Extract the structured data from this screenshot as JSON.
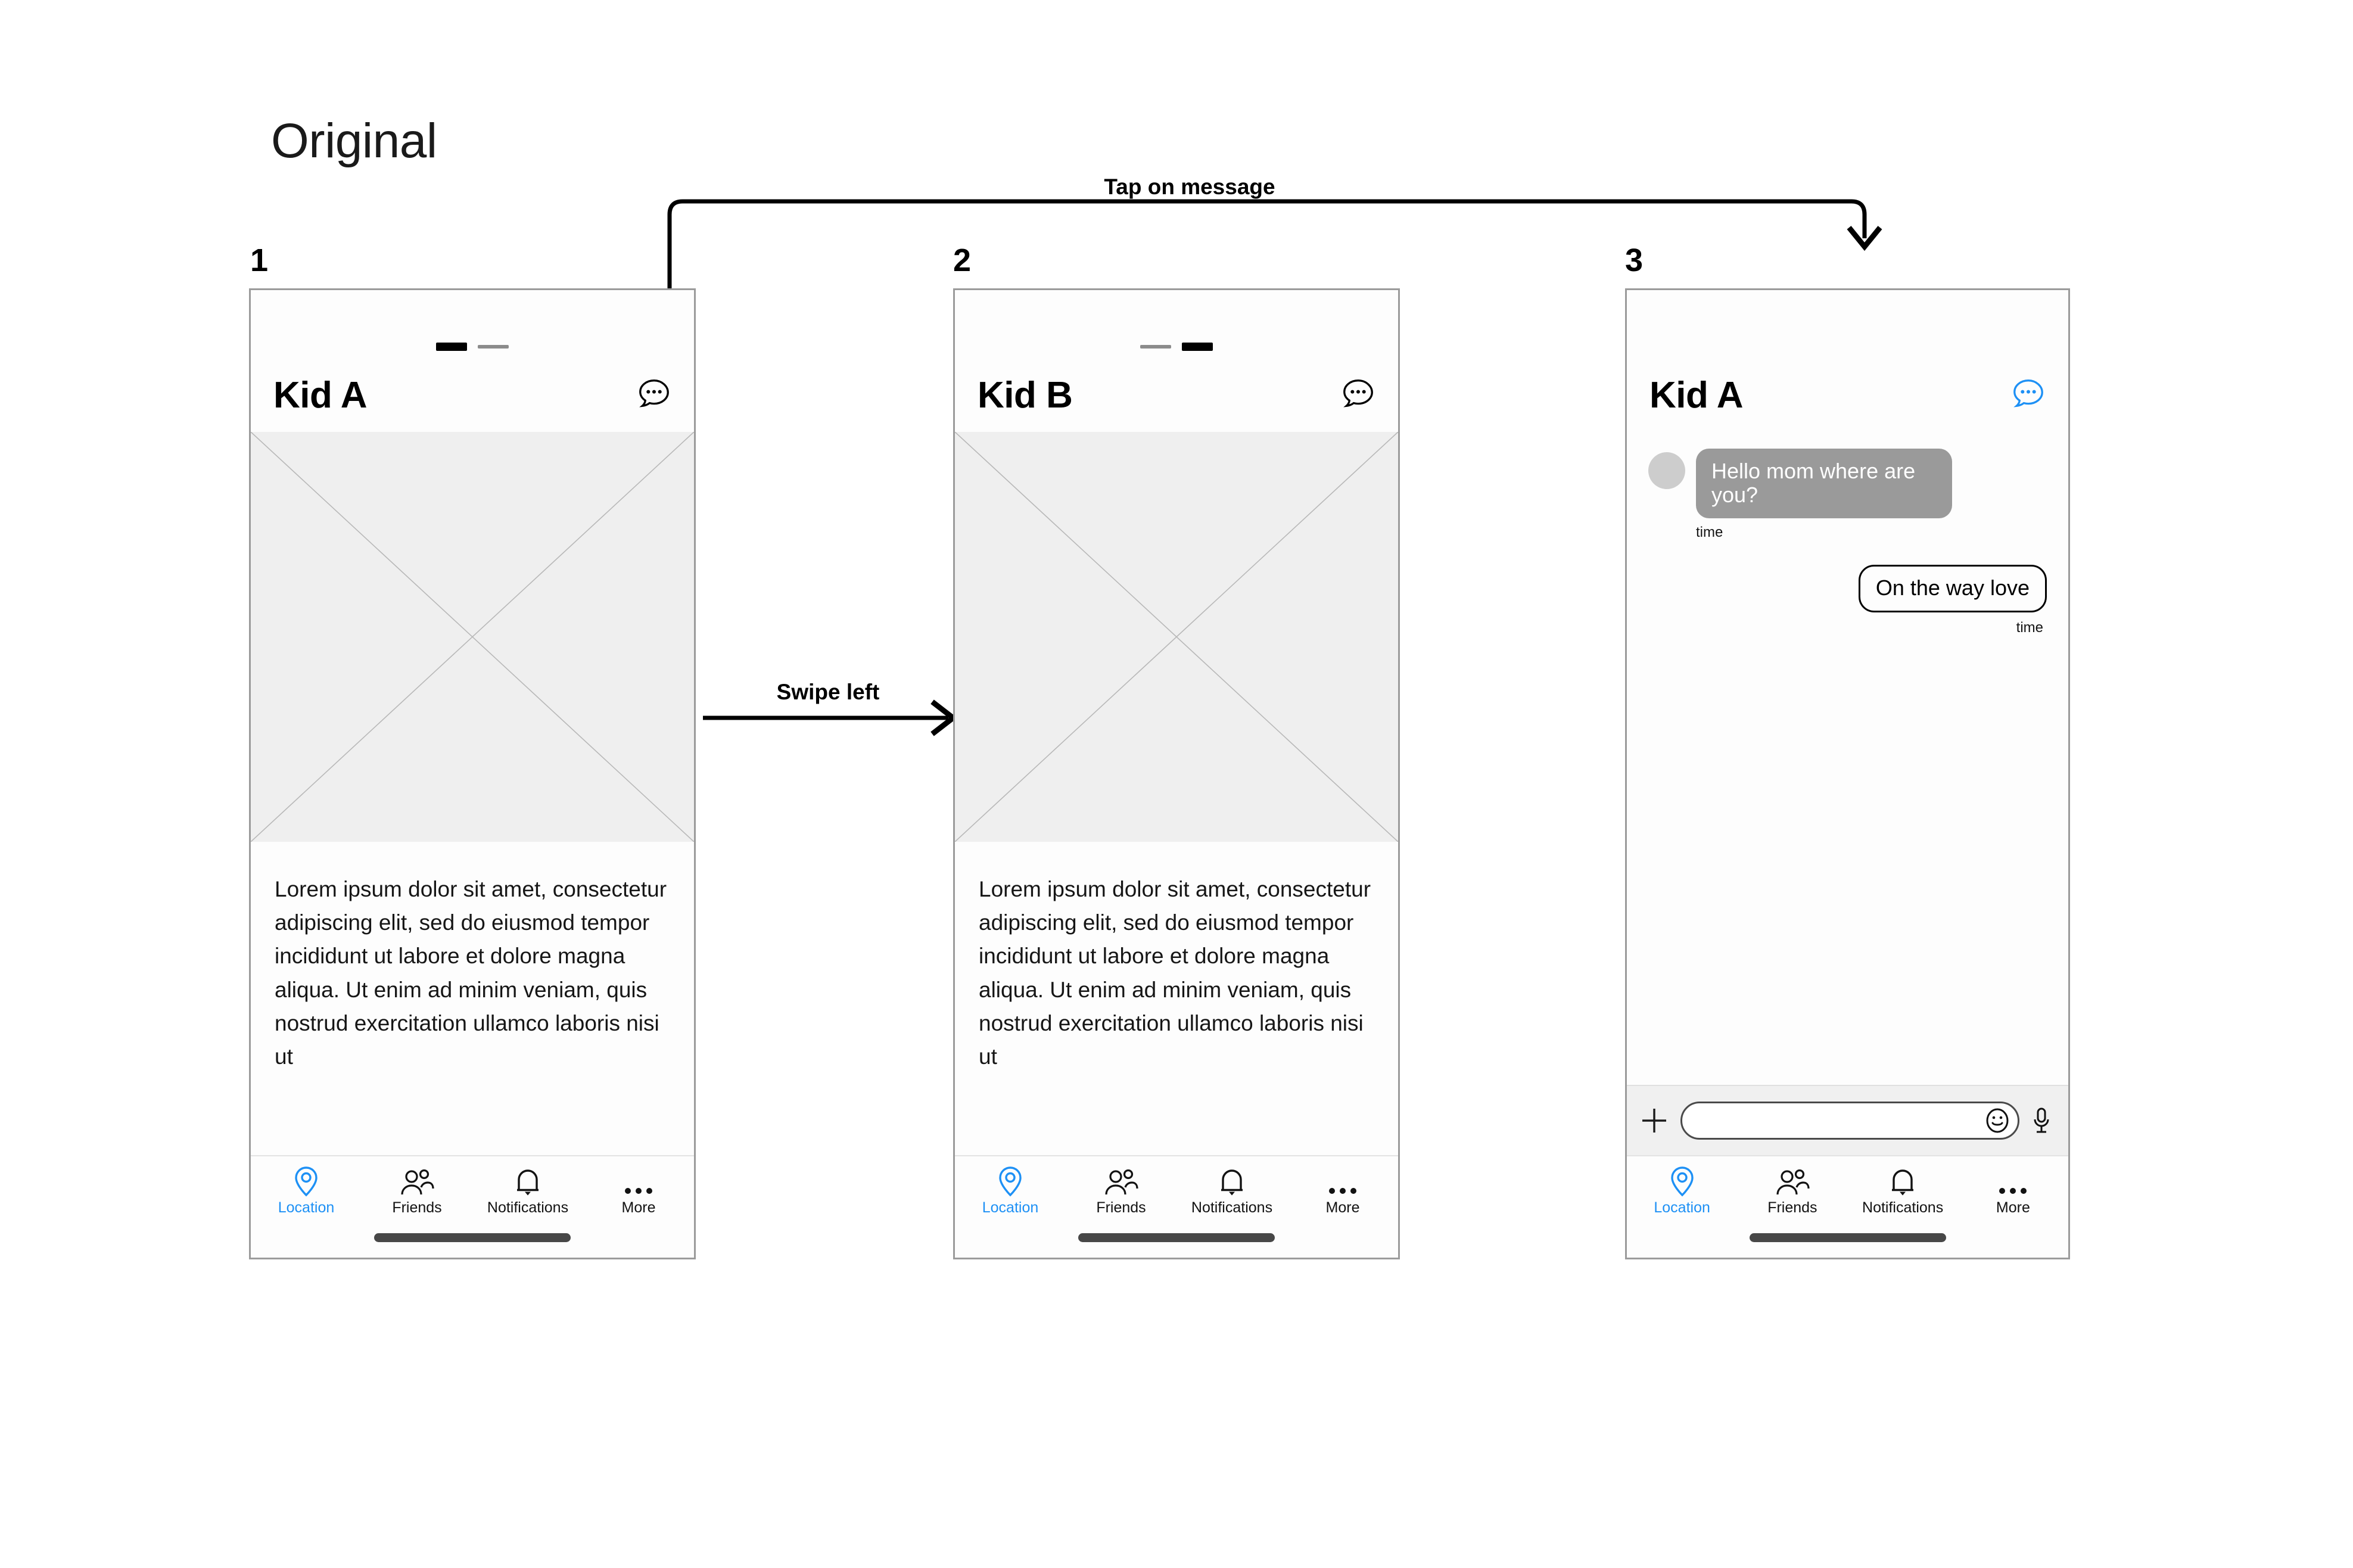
{
  "page": {
    "title": "Original"
  },
  "annotations": [
    {
      "id": "tap-on-message",
      "label": "Tap on message"
    },
    {
      "id": "swipe-left",
      "label": "Swipe left"
    }
  ],
  "screens": [
    {
      "number": "1",
      "title": "Kid A",
      "chat_icon": "chat-bubble-dots-icon",
      "chat_icon_color": "#000000",
      "page_dots": [
        {
          "state": "active",
          "color": "#000000"
        },
        {
          "state": "inactive",
          "color": "#8c8c8c"
        }
      ],
      "image_placeholder": "image-placeholder-cross",
      "body_text": "Lorem ipsum dolor sit amet, consectetur adipiscing elit, sed do eiusmod tempor incididunt ut labore et dolore magna aliqua. Ut enim ad minim veniam, quis nostrud exercitation ullamco laboris nisi ut",
      "tabs": [
        {
          "label": "Location",
          "icon": "location-pin-icon",
          "active": true
        },
        {
          "label": "Friends",
          "icon": "friends-people-icon",
          "active": false
        },
        {
          "label": "Notifications",
          "icon": "bell-icon",
          "active": false
        },
        {
          "label": "More",
          "icon": "ellipsis-icon",
          "active": false
        }
      ]
    },
    {
      "number": "2",
      "title": "Kid B",
      "chat_icon": "chat-bubble-dots-icon",
      "chat_icon_color": "#000000",
      "page_dots": [
        {
          "state": "inactive",
          "color": "#8c8c8c"
        },
        {
          "state": "active",
          "color": "#000000"
        }
      ],
      "image_placeholder": "image-placeholder-cross",
      "body_text": "Lorem ipsum dolor sit amet, consectetur adipiscing elit, sed do eiusmod tempor incididunt ut labore et dolore magna aliqua. Ut enim ad minim veniam, quis nostrud exercitation ullamco laboris nisi ut",
      "tabs": [
        {
          "label": "Location",
          "icon": "location-pin-icon",
          "active": true
        },
        {
          "label": "Friends",
          "icon": "friends-people-icon",
          "active": false
        },
        {
          "label": "Notifications",
          "icon": "bell-icon",
          "active": false
        },
        {
          "label": "More",
          "icon": "ellipsis-icon",
          "active": false
        }
      ]
    },
    {
      "number": "3",
      "title": "Kid A",
      "chat_icon": "chat-bubble-dots-icon",
      "chat_icon_color": "#1d90f5",
      "messages": [
        {
          "direction": "incoming",
          "text": "Hello mom where are you?",
          "time": "time",
          "avatar": "avatar-circle",
          "bubble_color": "#9a9a9a",
          "text_color": "#ffffff"
        },
        {
          "direction": "outgoing",
          "text": "On the way love",
          "time": "time",
          "bubble_color": "#fdfdfd",
          "text_color": "#000000"
        }
      ],
      "input_bar": {
        "add_icon": "plus-icon",
        "emoji_icon": "smiley-face-icon",
        "mic_icon": "microphone-icon",
        "input_value": "",
        "input_placeholder": ""
      },
      "tabs": [
        {
          "label": "Location",
          "icon": "location-pin-icon",
          "active": true
        },
        {
          "label": "Friends",
          "icon": "friends-people-icon",
          "active": false
        },
        {
          "label": "Notifications",
          "icon": "bell-icon",
          "active": false
        },
        {
          "label": "More",
          "icon": "ellipsis-icon",
          "active": false
        }
      ]
    }
  ],
  "colors": {
    "accent": "#1d90f5",
    "frame_border": "#9b9b9b",
    "placeholder_bg": "#efefef",
    "bubble_incoming": "#9a9a9a",
    "input_bar_bg": "#f0f0f0"
  }
}
